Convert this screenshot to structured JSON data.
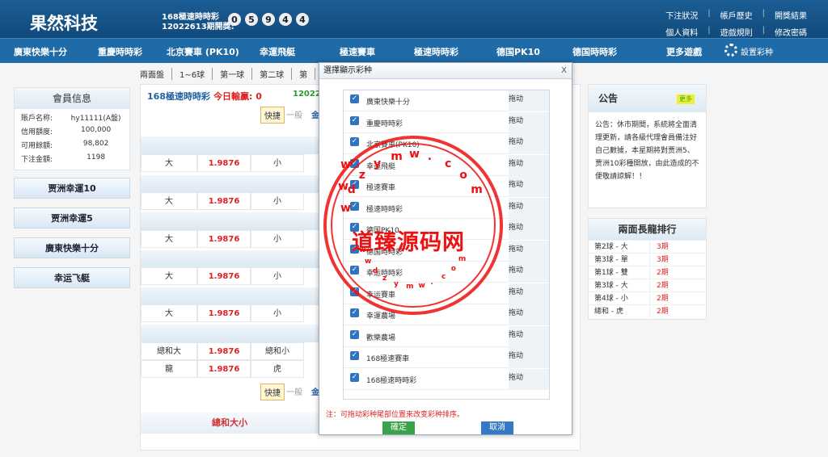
{
  "header": {
    "logo": "果然科技",
    "lottery_name": "168極速時時彩",
    "period": "12022613期開獎:",
    "balls": [
      "0",
      "5",
      "9",
      "4",
      "4"
    ],
    "links_row1": [
      "下注狀況",
      "帳戶歷史",
      "開獎結果"
    ],
    "links_row2": [
      "個人資料",
      "遊戲規則",
      "修改密碼"
    ]
  },
  "nav": {
    "items": [
      "廣東快樂十分",
      "重慶時時彩",
      "北京賽車 (PK10)",
      "幸運飛艇",
      "極速賽車",
      "極速時時彩",
      "德国PK10",
      "德国時時彩",
      "更多遊戲"
    ],
    "settings": "設置彩种"
  },
  "subtabs": [
    "兩面盤",
    "1~6球",
    "第一球",
    "第二球",
    "第"
  ],
  "member": {
    "title": "會員信息",
    "rows": [
      {
        "k": "賬戶名称:",
        "v": "hy11111(A盤)"
      },
      {
        "k": "信用額度:",
        "v": "100,000"
      },
      {
        "k": "可用餘額:",
        "v": "98,802"
      },
      {
        "k": "下注金額:",
        "v": "1198"
      }
    ]
  },
  "side_buttons": [
    "贾洲幸運10",
    "贾洲幸運5",
    "廣東快樂十分",
    "幸运飞艇"
  ],
  "game": {
    "title": "168極速時時彩",
    "today": "今日輸贏:",
    "today_value": "0",
    "period_partial": "120226",
    "quick": "快捷",
    "normal": "一般",
    "jin": "金"
  },
  "bet_rows": [
    {
      "a": "大",
      "o": "1.9876",
      "b": "小"
    },
    {
      "a": "大",
      "o": "1.9876",
      "b": "小"
    },
    {
      "a": "大",
      "o": "1.9876",
      "b": "小"
    },
    {
      "a": "大",
      "o": "1.9876",
      "b": "小"
    },
    {
      "a": "大",
      "o": "1.9876",
      "b": "小"
    }
  ],
  "sum_rows": [
    {
      "a": "總和大",
      "o": "1.9876",
      "b": "總和小"
    },
    {
      "a": "龍",
      "o": "1.9876",
      "b": "虎"
    }
  ],
  "sum_title": "總和大小",
  "notice": {
    "title": "公告",
    "badge": "更多",
    "text": "公告：休市期間，系統將全面清理更新，請各級代理會員備注好自己數據，本星期將對贾洲5、贾洲10彩種開放，由此造成的不便敬請諒解！！"
  },
  "ranking": {
    "title": "兩面長龍排行",
    "rows": [
      {
        "n": "第2球 - 大",
        "p": "3期"
      },
      {
        "n": "第3球 - 單",
        "p": "3期"
      },
      {
        "n": "第1球 - 雙",
        "p": "2期"
      },
      {
        "n": "第3球 - 大",
        "p": "2期"
      },
      {
        "n": "第4球 - 小",
        "p": "2期"
      },
      {
        "n": "總和 - 虎",
        "p": "2期"
      }
    ]
  },
  "modal": {
    "title": "選擇顯示彩种",
    "close": "X",
    "drag_label": "拖动",
    "items": [
      "廣東快樂十分",
      "重慶時時彩",
      "北京賽車(PK10)",
      "幸運飛艇",
      "極速賽車",
      "極速時時彩",
      "德国PK10",
      "德国時時彩",
      "幸运時時彩",
      "幸运賽車",
      "幸運農場",
      "歡樂農場",
      "168極速賽車",
      "168極速時時彩"
    ],
    "note": "注：可拖动彩种尾部位置来改变彩种排序。",
    "confirm": "確定",
    "cancel": "取消"
  },
  "watermark": {
    "text": "道臻源码网",
    "url_top": [
      "d",
      "z",
      "y",
      "m",
      "w",
      ".",
      "c",
      "o",
      "m"
    ],
    "url_bottom": [
      "w",
      "w",
      "d",
      "z",
      "y",
      "m",
      "w",
      ".",
      "c",
      "o",
      "m"
    ],
    "left": [
      "w",
      "w",
      "w"
    ]
  },
  "colors": {
    "topbar": "#1a5d94",
    "nav": "#1e6ba8",
    "odds": "#dd2222",
    "stamp": "#ee1111",
    "confirm_btn": "#3aa24a",
    "cancel_btn": "#3578c4"
  }
}
